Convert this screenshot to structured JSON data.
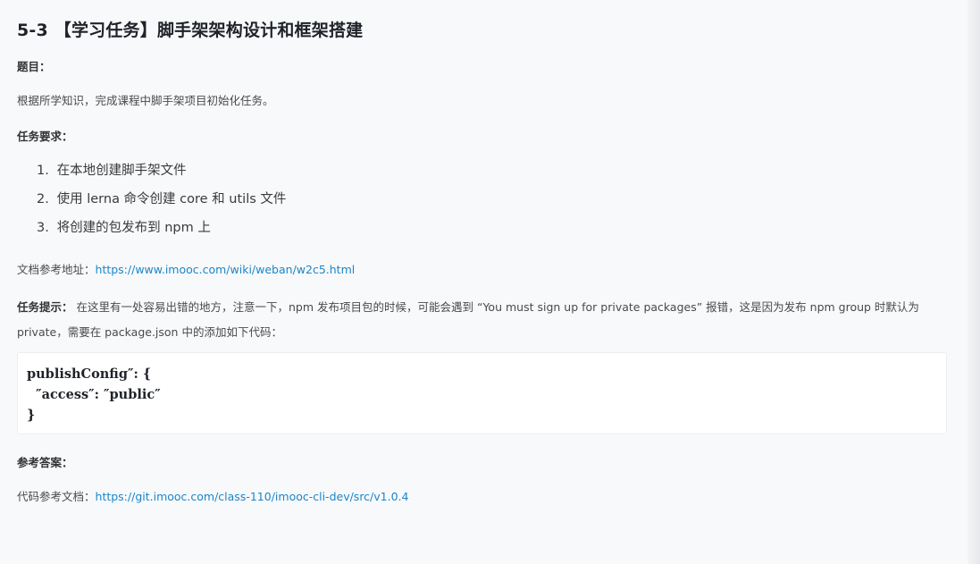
{
  "title": "5-3 【学习任务】脚手架架构设计和框架搭建",
  "topic": {
    "label": "题目：",
    "text": "根据所学知识，完成课程中脚手架项目初始化任务。"
  },
  "requirements": {
    "label": "任务要求：",
    "items": [
      {
        "num": "1.",
        "text": "在本地创建脚手架文件"
      },
      {
        "num": "2.",
        "text": "使用 lerna 命令创建 core 和 utils 文件"
      },
      {
        "num": "3.",
        "text": "将创建的包发布到 npm 上"
      }
    ]
  },
  "doc_ref": {
    "label": "文档参考地址：",
    "url": "https://www.imooc.com/wiki/weban/w2c5.html"
  },
  "hint": {
    "label": "任务提示：",
    "text": "在这里有一处容易出错的地方，注意一下，npm 发布项目包的时候，可能会遇到 “You must sign up for private packages” 报错，这是因为发布 npm group 时默认为 private，需要在 package.json 中的添加如下代码："
  },
  "code": {
    "lines": [
      "publishConfig″: {",
      "  ″access″: ″public″",
      "}"
    ]
  },
  "answer": {
    "label": "参考答案：",
    "code_ref_label": "代码参考文档：",
    "url": "https://git.imooc.com/class-110/imooc-cli-dev/src/v1.0.4"
  }
}
